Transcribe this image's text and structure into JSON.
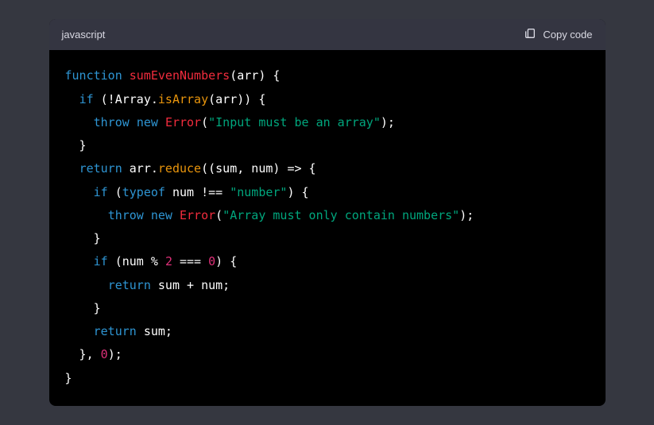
{
  "header": {
    "language": "javascript",
    "copy_label": "Copy code"
  },
  "code": {
    "tokens": [
      [
        {
          "c": "kw",
          "t": "function"
        },
        {
          "c": "default",
          "t": " "
        },
        {
          "c": "fn",
          "t": "sumEvenNumbers"
        },
        {
          "c": "default",
          "t": "(arr) {"
        }
      ],
      [
        {
          "c": "default",
          "t": "  "
        },
        {
          "c": "kw",
          "t": "if"
        },
        {
          "c": "default",
          "t": " (!"
        },
        {
          "c": "default",
          "t": "Array"
        },
        {
          "c": "default",
          "t": "."
        },
        {
          "c": "method",
          "t": "isArray"
        },
        {
          "c": "default",
          "t": "(arr)) {"
        }
      ],
      [
        {
          "c": "default",
          "t": "    "
        },
        {
          "c": "kw",
          "t": "throw"
        },
        {
          "c": "default",
          "t": " "
        },
        {
          "c": "kw",
          "t": "new"
        },
        {
          "c": "default",
          "t": " "
        },
        {
          "c": "fn",
          "t": "Error"
        },
        {
          "c": "default",
          "t": "("
        },
        {
          "c": "str",
          "t": "\"Input must be an array\""
        },
        {
          "c": "default",
          "t": ");"
        }
      ],
      [
        {
          "c": "default",
          "t": "  }"
        }
      ],
      [
        {
          "c": "default",
          "t": "  "
        },
        {
          "c": "kw",
          "t": "return"
        },
        {
          "c": "default",
          "t": " arr."
        },
        {
          "c": "method",
          "t": "reduce"
        },
        {
          "c": "default",
          "t": "((sum, num) => {"
        }
      ],
      [
        {
          "c": "default",
          "t": "    "
        },
        {
          "c": "kw",
          "t": "if"
        },
        {
          "c": "default",
          "t": " ("
        },
        {
          "c": "kw",
          "t": "typeof"
        },
        {
          "c": "default",
          "t": " num !== "
        },
        {
          "c": "str",
          "t": "\"number\""
        },
        {
          "c": "default",
          "t": ") {"
        }
      ],
      [
        {
          "c": "default",
          "t": "      "
        },
        {
          "c": "kw",
          "t": "throw"
        },
        {
          "c": "default",
          "t": " "
        },
        {
          "c": "kw",
          "t": "new"
        },
        {
          "c": "default",
          "t": " "
        },
        {
          "c": "fn",
          "t": "Error"
        },
        {
          "c": "default",
          "t": "("
        },
        {
          "c": "str",
          "t": "\"Array must only contain numbers\""
        },
        {
          "c": "default",
          "t": ");"
        }
      ],
      [
        {
          "c": "default",
          "t": "    }"
        }
      ],
      [
        {
          "c": "default",
          "t": "    "
        },
        {
          "c": "kw",
          "t": "if"
        },
        {
          "c": "default",
          "t": " (num % "
        },
        {
          "c": "num",
          "t": "2"
        },
        {
          "c": "default",
          "t": " === "
        },
        {
          "c": "num",
          "t": "0"
        },
        {
          "c": "default",
          "t": ") {"
        }
      ],
      [
        {
          "c": "default",
          "t": "      "
        },
        {
          "c": "kw",
          "t": "return"
        },
        {
          "c": "default",
          "t": " sum + num;"
        }
      ],
      [
        {
          "c": "default",
          "t": "    }"
        }
      ],
      [
        {
          "c": "default",
          "t": "    "
        },
        {
          "c": "kw",
          "t": "return"
        },
        {
          "c": "default",
          "t": " sum;"
        }
      ],
      [
        {
          "c": "default",
          "t": "  }, "
        },
        {
          "c": "num",
          "t": "0"
        },
        {
          "c": "default",
          "t": ");"
        }
      ],
      [
        {
          "c": "default",
          "t": "}"
        }
      ]
    ]
  }
}
